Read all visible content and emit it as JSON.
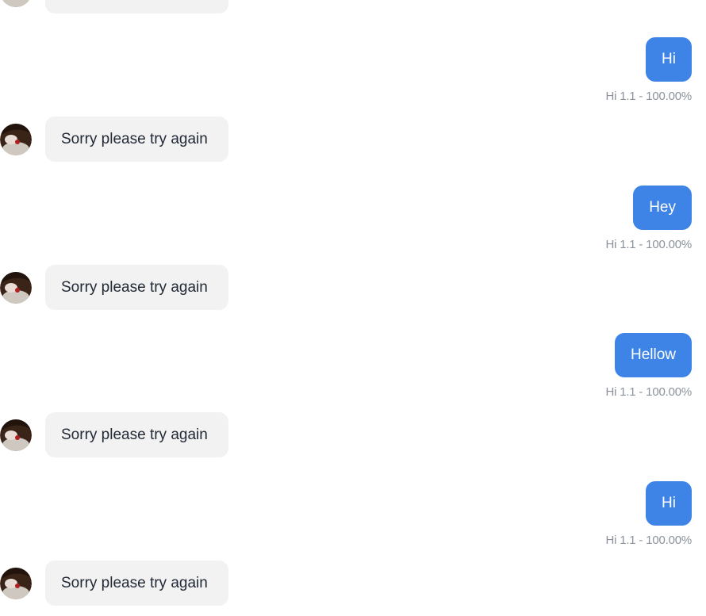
{
  "messages": [
    {
      "role": "user",
      "text": "Hi",
      "meta": "Hi 1.1 - 100.00%"
    },
    {
      "role": "bot",
      "text": "Sorry please try again"
    },
    {
      "role": "user",
      "text": "Hey",
      "meta": "Hi 1.1 - 100.00%"
    },
    {
      "role": "bot",
      "text": "Sorry please try again"
    },
    {
      "role": "user",
      "text": "Hellow",
      "meta": "Hi 1.1 - 100.00%"
    },
    {
      "role": "bot",
      "text": "Sorry please try again"
    },
    {
      "role": "user",
      "text": "Hi",
      "meta": "Hi 1.1 - 100.00%"
    },
    {
      "role": "bot",
      "text": "Sorry please try again"
    }
  ],
  "avatar_icon": "bot-avatar-icon",
  "colors": {
    "user_bubble": "#3d84e6",
    "bot_bubble": "#f2f2f3",
    "meta_text": "#8b929c",
    "bot_text": "#222a35"
  }
}
